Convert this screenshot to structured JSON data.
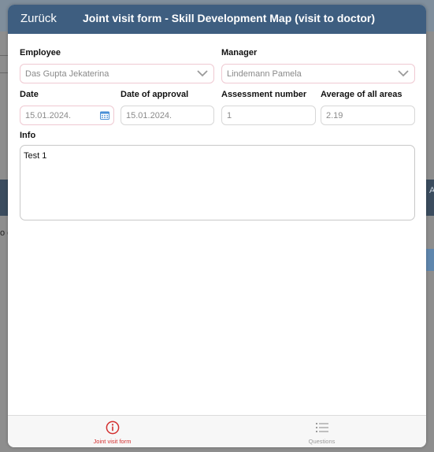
{
  "header": {
    "back_label": "Zurück",
    "title": "Joint visit form - Skill Development Map (visit to doctor)"
  },
  "form": {
    "employee": {
      "label": "Employee",
      "value": "Das Gupta Jekaterina"
    },
    "manager": {
      "label": "Manager",
      "value": "Lindemann Pamela"
    },
    "date": {
      "label": "Date",
      "value": "15.01.2024."
    },
    "date_of_approval": {
      "label": "Date of approval",
      "value": "15.01.2024."
    },
    "assessment_number": {
      "label": "Assessment number",
      "value": "1"
    },
    "average": {
      "label": "Average of all areas",
      "value": "2.19"
    },
    "info": {
      "label": "Info",
      "value": "Test 1"
    }
  },
  "tabs": [
    {
      "label": "Joint visit form",
      "icon": "info-circle-icon",
      "active": true
    },
    {
      "label": "Questions",
      "icon": "list-icon",
      "active": false
    }
  ],
  "colors": {
    "header_bg": "#3e5e80",
    "active_tab": "#d32f2f",
    "inactive_tab": "#9a9a9a",
    "calendar_icon": "#4a8fd6"
  }
}
